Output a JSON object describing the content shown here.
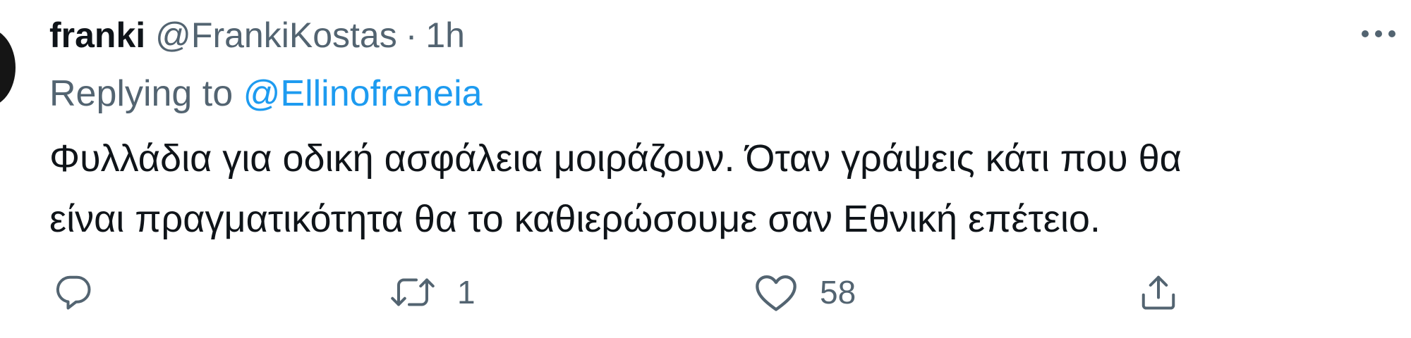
{
  "tweet": {
    "display_name": "franki",
    "handle": "@FrankiKostas",
    "separator": "·",
    "time": "1h",
    "more_icon": "more-horizontal-icon",
    "replying_prefix": "Replying to",
    "replying_to": "@Ellinofreneia",
    "text_lines": [
      "Φυλλάδια για οδική ασφάλεια μοιράζουν. Όταν γράψεις κάτι που θα",
      "είναι πραγματικότητα θα το καθιερώσουμε σαν Εθνική επέτειο."
    ]
  },
  "actions": {
    "reply": {
      "icon": "reply-icon",
      "count": ""
    },
    "retweet": {
      "icon": "retweet-icon",
      "count": "1"
    },
    "like": {
      "icon": "heart-icon",
      "count": "58"
    },
    "share": {
      "icon": "share-icon",
      "count": ""
    }
  },
  "colors": {
    "text": "#0f1419",
    "secondary": "#536471",
    "link": "#1d9bf0",
    "background": "#ffffff"
  }
}
